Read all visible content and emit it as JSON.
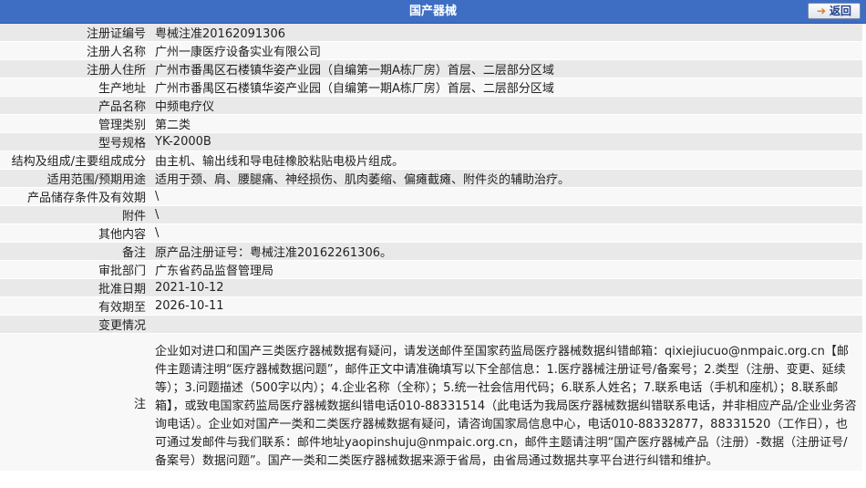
{
  "header": {
    "title": "国产器械",
    "back_label": "返回"
  },
  "rows": [
    {
      "label": "注册证编号",
      "value": "粤械注准20162091306"
    },
    {
      "label": "注册人名称",
      "value": "广州一康医疗设备实业有限公司"
    },
    {
      "label": "注册人住所",
      "value": "广州市番禺区石楼镇华姿产业园（自编第一期A栋厂房）首层、二层部分区域"
    },
    {
      "label": "生产地址",
      "value": "广州市番禺区石楼镇华姿产业园（自编第一期A栋厂房）首层、二层部分区域"
    },
    {
      "label": "产品名称",
      "value": "中频电疗仪"
    },
    {
      "label": "管理类别",
      "value": "第二类"
    },
    {
      "label": "型号规格",
      "value": "YK-2000B"
    },
    {
      "label": "结构及组成/主要组成成分",
      "value": "由主机、输出线和导电硅橡胶粘贴电极片组成。"
    },
    {
      "label": "适用范围/预期用途",
      "value": "适用于颈、肩、腰腿痛、神经损伤、肌肉萎缩、偏瘫截瘫、附件炎的辅助治疗。"
    },
    {
      "label": "产品储存条件及有效期",
      "value": "\\"
    },
    {
      "label": "附件",
      "value": "\\"
    },
    {
      "label": "其他内容",
      "value": "\\"
    },
    {
      "label": "备注",
      "value": "原产品注册证号：粤械注准20162261306。"
    },
    {
      "label": "审批部门",
      "value": "广东省药品监督管理局"
    },
    {
      "label": "批准日期",
      "value": "2021-10-12"
    },
    {
      "label": "有效期至",
      "value": "2026-10-11"
    },
    {
      "label": "变更情况",
      "value": ""
    }
  ],
  "note": {
    "label": "注",
    "text": "企业如对进口和国产三类医疗器械数据有疑问，请发送邮件至国家药监局医疗器械数据纠错邮箱：qixiejiucuo@nmpaic.org.cn【邮件主题请注明“医疗器械数据问题”，邮件正文中请准确填写以下全部信息：1.医疗器械注册证号/备案号；2.类型（注册、变更、延续等）；3.问题描述（500字以内）；4.企业名称（全称）；5.统一社会信用代码；6.联系人姓名；7.联系电话（手机和座机）；8.联系邮箱】，或致电国家药监局医疗器械数据纠错电话010-88331514（此电话为我局医疗器械数据纠错联系电话，并非相应产品/企业业务咨询电话）。企业如对国产一类和二类医疗器械数据有疑问，请咨询国家局信息中心，电话010-88332877，88331520（工作日），也可通过发邮件与我们联系：邮件地址yaopinshuju@nmpaic.org.cn，邮件主题请注明“国产医疗器械产品（注册）-数据（注册证号/备案号）数据问题”。国产一类和二类医疗器械数据来源于省局，由省局通过数据共享平台进行纠错和维护。"
  }
}
